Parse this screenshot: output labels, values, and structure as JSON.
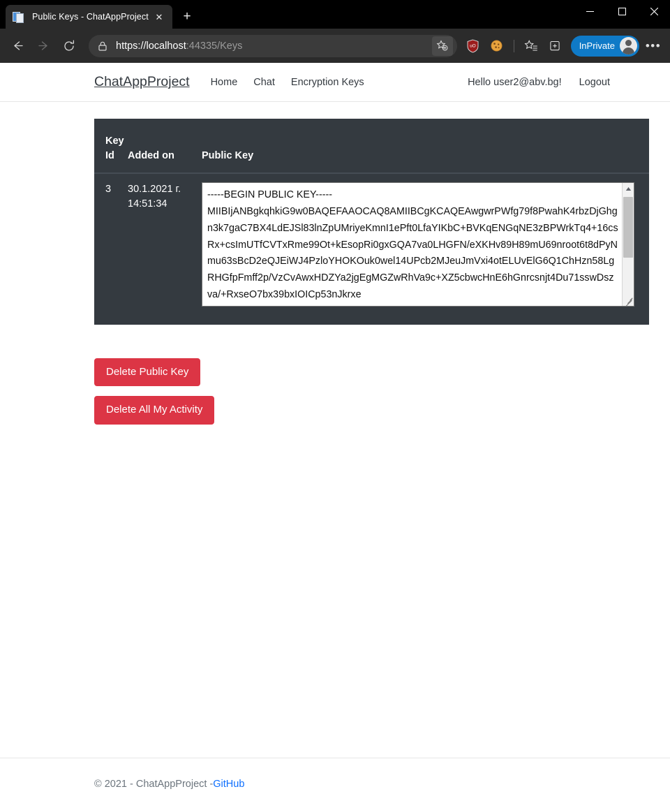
{
  "browser": {
    "tab": {
      "title": "Public Keys - ChatAppProject",
      "favicon": "document-icon",
      "close_label": "✕"
    },
    "new_tab_label": "+",
    "window_controls": {
      "minimize": "minimize-icon",
      "maximize": "maximize-icon",
      "close": "close-icon"
    },
    "toolbar": {
      "back": "back-arrow-icon",
      "forward": "forward-arrow-icon",
      "reload": "reload-icon",
      "site_info": "lock-icon",
      "url_scheme_host": "https://localhost",
      "url_rest": ":44335/Keys",
      "url_full": "https://localhost:44335/Keys",
      "add_favorite": "star-plus-icon",
      "extensions": [
        {
          "name": "ublock-origin-icon",
          "label": "uO"
        },
        {
          "name": "cookie-icon",
          "label": ""
        }
      ],
      "favorites": "star-list-icon",
      "collections": "collections-icon",
      "inprivate_label": "InPrivate",
      "profile": "avatar-icon",
      "settings_more": "•••"
    }
  },
  "site": {
    "brand": "ChatAppProject",
    "nav_links": [
      {
        "label": "Home"
      },
      {
        "label": "Chat"
      },
      {
        "label": "Encryption Keys"
      }
    ],
    "greeting": "Hello user2@abv.bg!",
    "logout_label": "Logout"
  },
  "table": {
    "headers": {
      "key_id": "Key Id",
      "added_on": "Added on",
      "public_key": "Public Key"
    },
    "rows": [
      {
        "key_id": "3",
        "added_on": "30.1.2021 г. 14:51:34",
        "public_key": "-----BEGIN PUBLIC KEY-----\nMIIBIjANBgkqhkiG9w0BAQEFAAOCAQ8AMIIBCgKCAQEAwgwrPWfg79f8PwahK4rbzDjGhgn3k7gaC7BX4LdEJSl83lnZpUMriyeKmnI1ePft0LfaYIKbC+BVKqENGqNE3zBPWrkTq4+16csRx+csImUTfCVTxRme99Ot+kEsopRi0gxGQA7va0LHGFN/eXKHv89H89mU69nroot6t8dPyNmu63sBcD2eQJEiWJ4PzloYHOKOuk0wel14UPcb2MJeuJmVxi4otELUvElG6Q1ChHzn58LgRHGfpFmff2p/VzCvAwxHDZYa2jgEgMGZwRhVa9c+XZ5cbwcHnE6hGnrcsnjt4Du71sswDszva/+RxseO7bx39bxIOICp53nJkrxe"
      }
    ]
  },
  "actions": {
    "delete_public_key": "Delete Public Key",
    "delete_all_activity": "Delete All My Activity"
  },
  "footer": {
    "text": "© 2021 - ChatAppProject - ",
    "link_label": "GitHub"
  },
  "colors": {
    "danger": "#dc3545",
    "table_dark": "#343a40",
    "link": "#0d6efd",
    "inprivate": "#0f7ac7"
  }
}
